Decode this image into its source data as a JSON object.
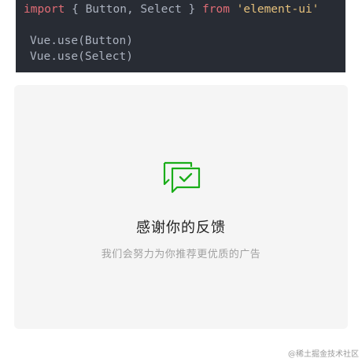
{
  "code": {
    "line1": {
      "keyword_import": "import",
      "middle": " { Button, Select } ",
      "keyword_from": "from",
      "string": " 'element-ui'"
    },
    "line2": "Vue.use(Button)",
    "line3": "Vue.use(Select)"
  },
  "feedback": {
    "icon": "chat-check-icon",
    "accent_color": "#1aad19",
    "title": "感谢你的反馈",
    "subtitle": "我们会努力为你推荐更优质的广告"
  },
  "watermark": "@稀土掘金技术社区"
}
